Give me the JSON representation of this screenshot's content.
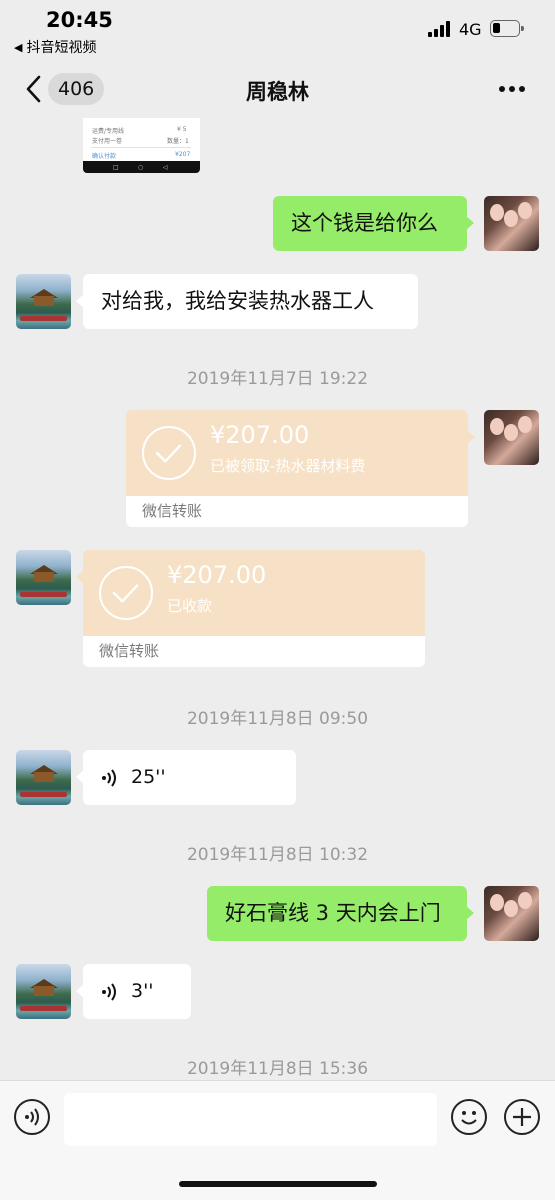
{
  "status_bar": {
    "time": "20:45",
    "back_app": "抖音短视频",
    "network": "4G"
  },
  "nav": {
    "unread_count": "406",
    "title": "周稳林"
  },
  "thumbnail": {
    "line1": "运费/专用线",
    "price": "¥ 5",
    "line2": "支付用一卷",
    "qty": "数量：1",
    "footer_left": "确认付款",
    "footer_right": "¥207"
  },
  "messages": [
    {
      "type": "text",
      "side": "right",
      "text": "这个钱是给你么"
    },
    {
      "type": "text",
      "side": "left",
      "text": "对给我，我给安装热水器工人"
    },
    {
      "type": "time",
      "text": "2019年11月7日 19:22"
    },
    {
      "type": "transfer",
      "side": "right",
      "amount": "¥207.00",
      "note": "已被领取-热水器材料费",
      "label": "微信转账"
    },
    {
      "type": "transfer",
      "side": "left",
      "amount": "¥207.00",
      "note": "已收款",
      "label": "微信转账"
    },
    {
      "type": "time",
      "text": "2019年11月8日 09:50"
    },
    {
      "type": "voice",
      "side": "left",
      "duration": "25''"
    },
    {
      "type": "time",
      "text": "2019年11月8日 10:32"
    },
    {
      "type": "text",
      "side": "right",
      "text": "好石膏线 3 天内会上门"
    },
    {
      "type": "voice",
      "side": "left",
      "duration": "3''"
    },
    {
      "type": "time",
      "text": "2019年11月8日 15:36"
    }
  ],
  "icons": {
    "back": "chevron-left-icon",
    "more": "more-icon",
    "voice_input": "voice-icon",
    "emoji": "emoji-icon",
    "plus": "plus-icon"
  },
  "colors": {
    "background": "#ededed",
    "bubble_sent": "#95ec69",
    "bubble_received": "#ffffff",
    "transfer": "#f6e1c6",
    "timestamp": "#9a9a9a"
  }
}
